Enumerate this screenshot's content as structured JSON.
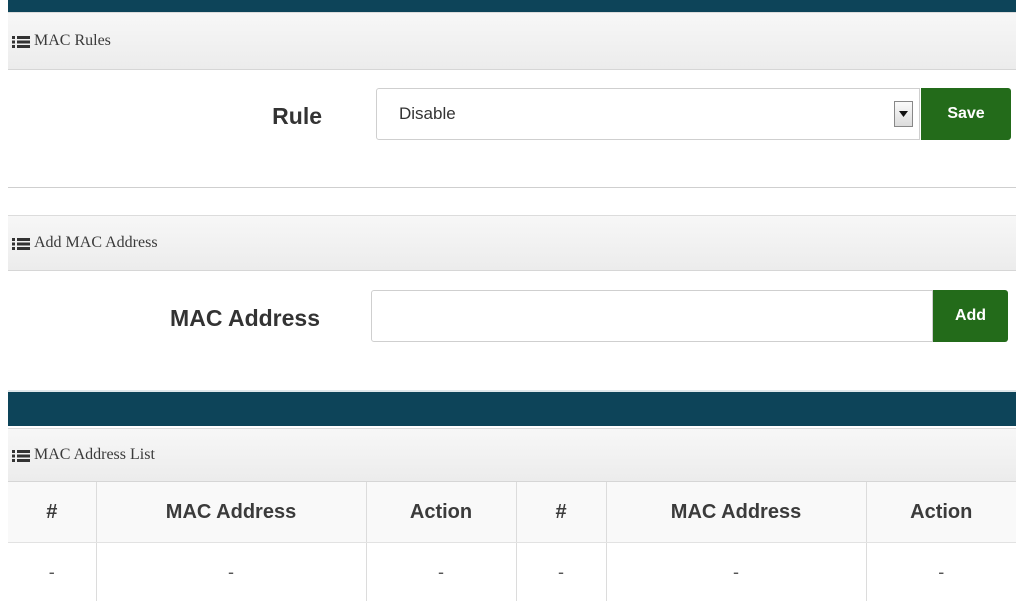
{
  "mac_rules": {
    "title": "MAC Rules",
    "rule_label": "Rule",
    "rule_value": "Disable",
    "save_label": "Save"
  },
  "add_mac": {
    "title": "Add MAC Address",
    "mac_label": "MAC Address",
    "mac_value": "",
    "add_label": "Add"
  },
  "mac_list": {
    "title": "MAC Address List",
    "columns": [
      "#",
      "MAC Address",
      "Action",
      "#",
      "MAC Address",
      "Action"
    ],
    "rows": [
      [
        "-",
        "-",
        "-",
        "-",
        "-",
        "-"
      ]
    ]
  },
  "icons": {
    "section_icon": "list-icon",
    "dropdown_icon": "caret-down-icon"
  },
  "colors": {
    "header_bar": "#0d4459",
    "button_green": "#236b1a"
  }
}
